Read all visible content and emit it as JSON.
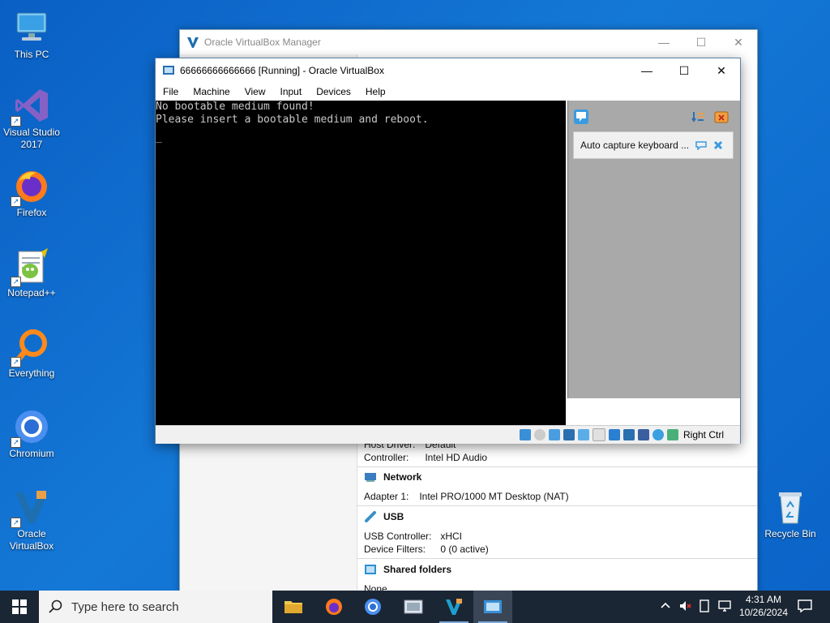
{
  "desktop": {
    "icons": [
      {
        "label": "This PC"
      },
      {
        "label": "Visual Studio 2017"
      },
      {
        "label": "Firefox"
      },
      {
        "label": "Notepad++"
      },
      {
        "label": "Everything"
      },
      {
        "label": "Chromium"
      },
      {
        "label": "Oracle VirtualBox"
      },
      {
        "label": "Recycle Bin"
      }
    ]
  },
  "manager": {
    "title": "Oracle VirtualBox Manager",
    "audio": {
      "host_driver_label": "Host Driver:",
      "host_driver_value": "Default",
      "controller_label": "Controller:",
      "controller_value": "Intel HD Audio"
    },
    "network": {
      "title": "Network",
      "adapter_label": "Adapter 1:",
      "adapter_value": "Intel PRO/1000 MT Desktop (NAT)"
    },
    "usb": {
      "title": "USB",
      "controller_label": "USB Controller:",
      "controller_value": "xHCI",
      "filters_label": "Device Filters:",
      "filters_value": "0 (0 active)"
    },
    "shared": {
      "title": "Shared folders",
      "value": "None"
    }
  },
  "vm": {
    "title": "66666666666666 [Running] - Oracle VirtualBox",
    "menu": [
      "File",
      "Machine",
      "View",
      "Input",
      "Devices",
      "Help"
    ],
    "screen_lines": [
      "No bootable medium found!",
      "Please insert a bootable medium and reboot.",
      "_"
    ],
    "notification": "Auto capture keyboard ...",
    "host_key": "Right Ctrl"
  },
  "taskbar": {
    "search_placeholder": "Type here to search",
    "time": "4:31 AM",
    "date": "10/26/2024"
  },
  "colors": {
    "desktop": "#0b63c8",
    "taskbar": "#1b2634",
    "vbox_blue": "#1d6fb0"
  }
}
